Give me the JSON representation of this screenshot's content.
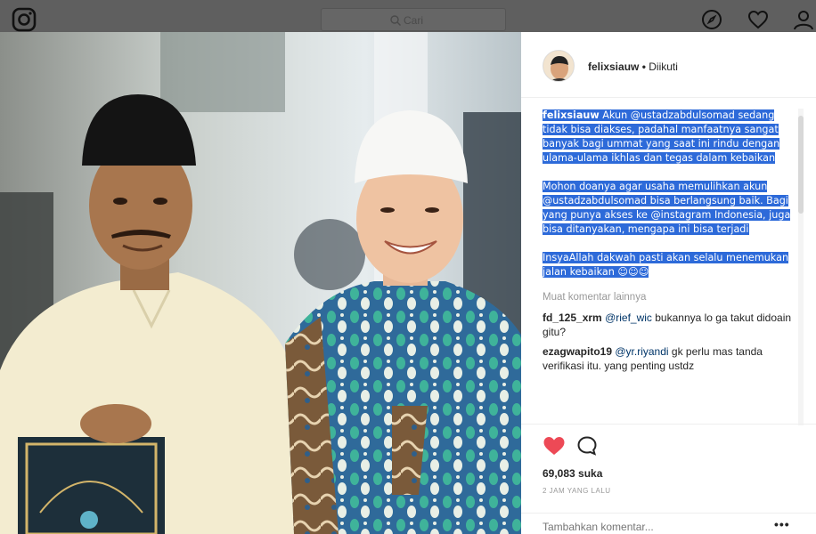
{
  "nav": {
    "logo_icon": "instagram-camera-icon",
    "search_placeholder": "Cari",
    "icons": [
      "compass-icon",
      "heart-icon",
      "person-icon"
    ]
  },
  "post": {
    "username": "felixsiauw",
    "separator": "•",
    "follow_status": "Diikuti",
    "caption": {
      "p1_user": "felixsiauw",
      "p1_text": "Akun @ustadzabdulsomad sedang tidak bisa diakses, padahal manfaatnya sangat banyak bagi ummat yang saat ini rindu dengan ulama-ulama ikhlas dan tegas dalam kebaikan",
      "p2_text": "Mohon doanya agar usaha memulihkan akun @ustadzabdulsomad bisa berlangsung baik. Bagi yang punya akses ke @instagram Indonesia, juga bisa ditanyakan, mengapa ini bisa terjadi",
      "p3_text": "InsyaAllah dakwah pasti akan selalu menemukan jalan kebaikan ☺☺☺"
    },
    "load_more": "Muat komentar lainnya",
    "comments": [
      {
        "user": "fd_125_xrm",
        "mention": "@rief_wic",
        "text": " bukannya lo ga takut didoain gitu?"
      },
      {
        "user": "ezagwapito19",
        "mention": "@yr.riyandi",
        "text": " gk perlu mas tanda verifikasi itu. yang penting ustdz"
      }
    ],
    "likes": "69,083 suka",
    "timestamp": "2 JAM YANG LALU",
    "add_comment_placeholder": "Tambahkan komentar...",
    "more_options": "•••",
    "colors": {
      "like": "#ed4956",
      "selection": "#2d6ad9",
      "mention": "#003569"
    }
  }
}
